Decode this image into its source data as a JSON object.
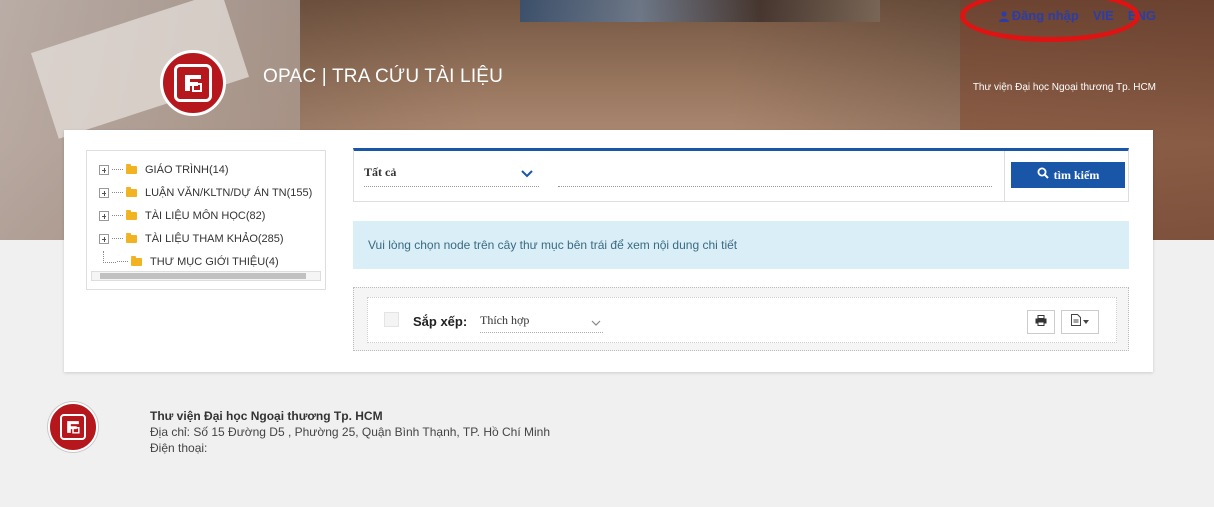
{
  "header": {
    "site_title": "OPAC | TRA CỨU TÀI LIỆU",
    "library_name": "Thư viện Đại học Ngoại thương Tp. HCM",
    "login_label": "Đăng nhập",
    "lang_vie": "VIE",
    "lang_eng": "ENG",
    "annotation_color": "#e01212"
  },
  "tree": {
    "items": [
      {
        "label": "GIÁO TRÌNH(14)"
      },
      {
        "label": "LUẬN VĂN/KLTN/DỰ ÁN TN(155)"
      },
      {
        "label": "TÀI LIỆU MÔN HỌC(82)"
      },
      {
        "label": "TÀI LIỆU THAM KHẢO(285)"
      },
      {
        "label": "THƯ MỤC GIỚI THIỆU(4)"
      }
    ]
  },
  "search": {
    "scope_value": "Tất cả",
    "query_value": "",
    "button_label": "tìm kiếm",
    "accent_color": "#1a56a8"
  },
  "info": {
    "message": "Vui lòng chọn node trên cây thư mục bên trái để xem nội dung chi tiết"
  },
  "sort": {
    "label": "Sắp xếp:",
    "value": "Thích hợp"
  },
  "footer": {
    "name": "Thư viện Đại học Ngoại thương Tp. HCM",
    "address": "Địa chỉ: Số 15 Đường D5 , Phường 25, Quận Bình Thạnh, TP. Hồ Chí Minh",
    "phone": "Điện thoại:"
  },
  "icons": {
    "user": "user-icon",
    "folder": "folder-icon",
    "search": "search-icon",
    "print": "print-icon",
    "export": "export-icon",
    "chevron": "chevron-down-icon"
  }
}
